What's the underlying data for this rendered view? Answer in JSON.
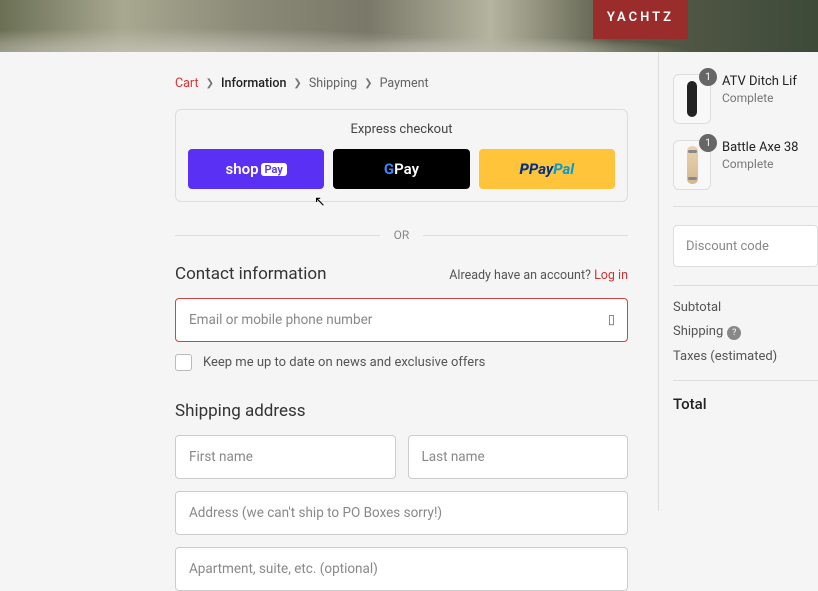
{
  "brand": "YACHTZ",
  "breadcrumb": {
    "cart": "Cart",
    "information": "Information",
    "shipping": "Shipping",
    "payment": "Payment"
  },
  "express": {
    "title": "Express checkout",
    "shop": {
      "prefix": "shop",
      "suffix": "Pay"
    },
    "gpay": {
      "g": "G",
      "pay": " Pay"
    },
    "paypal": {
      "p": "P",
      "pay": "Pay",
      "pal": "Pal"
    }
  },
  "separator": "OR",
  "contact": {
    "title": "Contact information",
    "have_account": "Already have an account? ",
    "login": "Log in",
    "email_placeholder": "Email or mobile phone number",
    "newsletter": "Keep me up to date on news and exclusive offers"
  },
  "shipping": {
    "title": "Shipping address",
    "first_name": "First name",
    "last_name": "Last name",
    "address": "Address (we can't ship to PO Boxes sorry!)",
    "apartment": "Apartment, suite, etc. (optional)"
  },
  "cart": {
    "items": [
      {
        "name": "ATV Ditch Lif",
        "meta": "Complete",
        "qty": "1"
      },
      {
        "name": "Battle Axe 38",
        "meta": "Complete",
        "qty": "1"
      }
    ],
    "discount_placeholder": "Discount code",
    "subtotal_label": "Subtotal",
    "shipping_label": "Shipping",
    "taxes_label": "Taxes (estimated)",
    "total_label": "Total"
  }
}
